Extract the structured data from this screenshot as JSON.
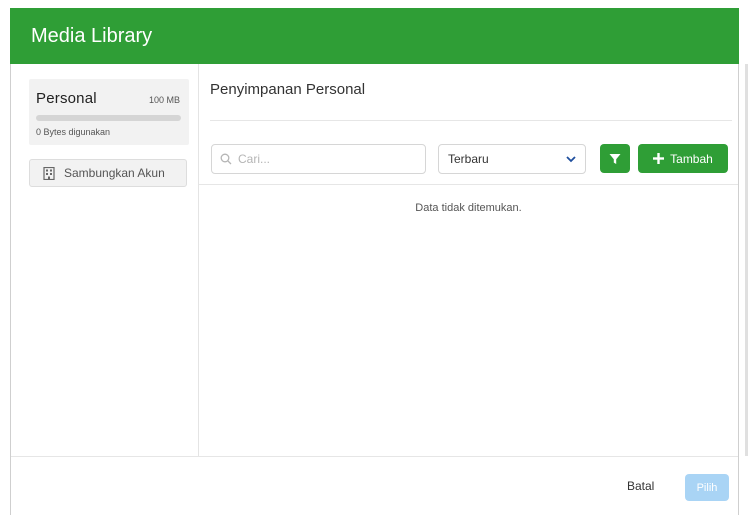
{
  "header": {
    "title": "Media Library"
  },
  "sidebar": {
    "storage": {
      "name": "Personal",
      "size": "100 MB",
      "used_label": "0 Bytes digunakan",
      "used_fraction": 0
    },
    "connect_label": "Sambungkan Akun"
  },
  "main": {
    "title": "Penyimpanan Personal",
    "search": {
      "placeholder": "Cari...",
      "value": ""
    },
    "sort": {
      "selected": "Terbaru"
    },
    "add_label": "Tambah",
    "empty_message": "Data tidak ditemukan."
  },
  "footer": {
    "cancel_label": "Batal",
    "select_label": "Pilih"
  },
  "colors": {
    "brand": "#2f9e36",
    "disabled_primary": "#a9d4f5"
  },
  "icons": {
    "connect": "building-icon",
    "search": "search-icon",
    "sort": "chevron-down-icon",
    "filter": "filter-icon",
    "add": "plus-icon"
  }
}
